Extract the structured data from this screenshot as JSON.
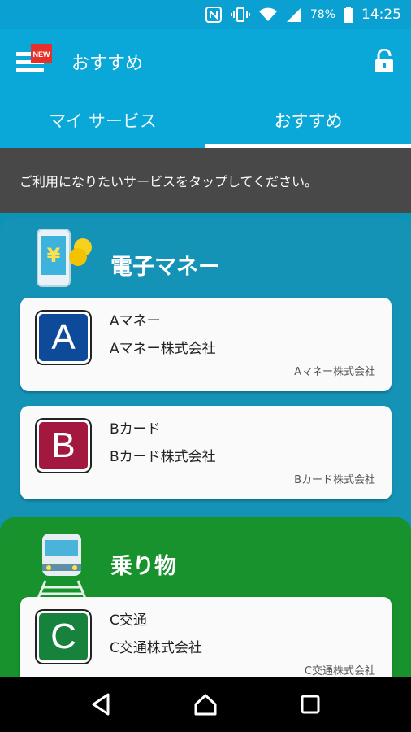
{
  "status_bar": {
    "battery_percent": "78%",
    "time": "14:25"
  },
  "app_bar": {
    "title": "おすすめ",
    "menu_badge": "NEW"
  },
  "tabs": [
    {
      "label": "マイ サービス",
      "active": false
    },
    {
      "label": "おすすめ",
      "active": true
    }
  ],
  "notice": "ご利用になりたいサービスをタップしてください。",
  "sections": [
    {
      "title": "電子マネー",
      "color": "#1593b6",
      "cards": [
        {
          "letter": "A",
          "name": "Aマネー",
          "company": "Aマネー株式会社",
          "issuer": "Aマネー株式会社",
          "logo_color": "#0e4a9a"
        },
        {
          "letter": "B",
          "name": "Bカード",
          "company": "Bカード株式会社",
          "issuer": "Bカード株式会社",
          "logo_color": "#a3183f"
        }
      ]
    },
    {
      "title": "乗り物",
      "color": "#17922c",
      "cards": [
        {
          "letter": "C",
          "name": "C交通",
          "company": "C交通株式会社",
          "issuer": "C交通株式会社",
          "logo_color": "#17823c"
        }
      ]
    }
  ]
}
